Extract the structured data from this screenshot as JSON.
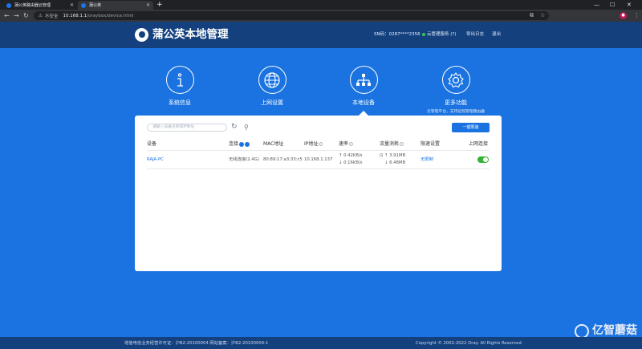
{
  "browser": {
    "tabs": [
      {
        "label": "蒲公英路由器云管理"
      },
      {
        "label": "蒲公英"
      }
    ],
    "insecure_label": "不安全",
    "url_host": "10.168.1.1",
    "url_path": "/oraybox/device.html"
  },
  "header": {
    "app_title": "蒲公英本地管理",
    "sn": "SN码：0287****2356",
    "cloud_service": "云管理服务 (?)",
    "logout_prefix": "导出日志",
    "logout": "退出"
  },
  "nav": [
    {
      "label": "系统信息"
    },
    {
      "label": "上网设置"
    },
    {
      "label": "本地设备"
    },
    {
      "label": "更多功能",
      "sub": "云管理平台，支持远程管理路由器"
    }
  ],
  "toolbar": {
    "search_placeholder": "请输入设备名称或IP地址",
    "one_key_button": "一键限速"
  },
  "table": {
    "headers": {
      "device": "设备",
      "connection": "连接",
      "mac": "MAC地址",
      "ip": "IP地址",
      "speed": "速率",
      "traffic": "流量消耗",
      "limit": "限速设置",
      "online": "上网连接"
    },
    "rows": [
      {
        "device": "RAJA-PC",
        "connection": "无线连接(2.4G)",
        "mac": "80:89:17:a3:33:c5",
        "ip": "10.168.1.137",
        "speed_up": "↑ 0.42KB/s",
        "speed_down": "↓ 0.16KB/s",
        "traffic_up": "↑ 3.91MB",
        "traffic_down": "↓ 6.48MB",
        "limit": "无限制",
        "online_enabled": true
      }
    ]
  },
  "footer": {
    "license": "增值电信业务经营许可证：沪B2-20100004  网站备案：沪B2-20100004-1",
    "copyright": "Copyright © 2002-2022 Oray. All Rights Reserved"
  },
  "watermark": "亿智蘑菇",
  "colors": {
    "header_bg": "#14417e",
    "page_bg": "#1a73e0",
    "accent": "#1a73e0",
    "toggle_on": "#34b233"
  }
}
